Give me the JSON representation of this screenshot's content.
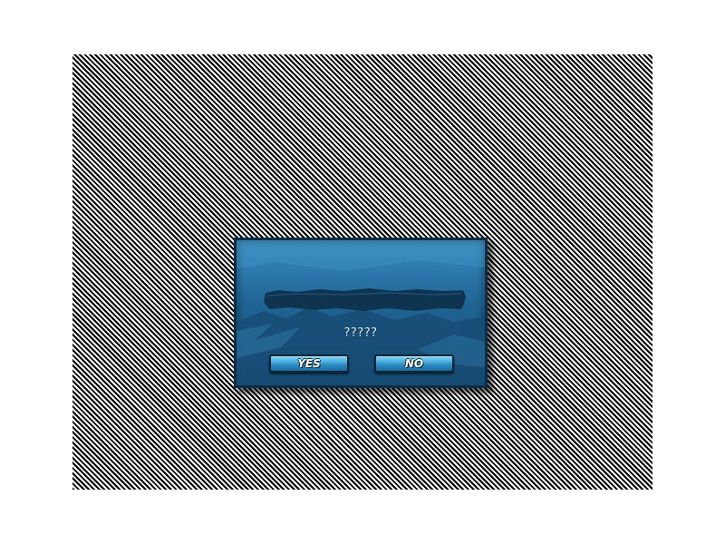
{
  "dialog": {
    "message": "?????",
    "yes_label": "YES",
    "no_label": "NO"
  },
  "colors": {
    "panel": "#1f6494",
    "panel_border": "#0b2d45",
    "button": "#4fb3e2",
    "title_bar": "#0e324c"
  }
}
